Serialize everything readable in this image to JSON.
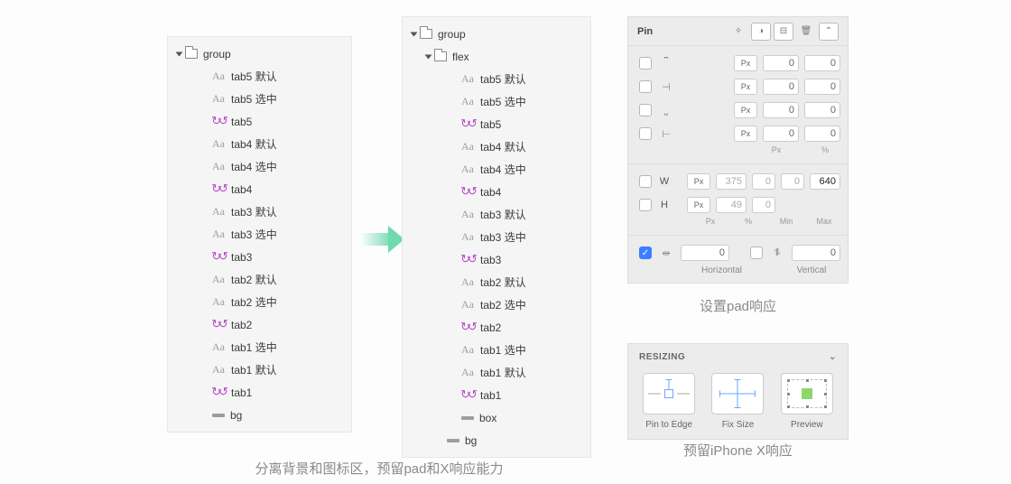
{
  "left_tree": {
    "root_label": "group",
    "items": [
      {
        "icon": "text",
        "label": "tab5 默认"
      },
      {
        "icon": "text",
        "label": "tab5 选中"
      },
      {
        "icon": "artboard",
        "label": "tab5"
      },
      {
        "icon": "text",
        "label": "tab4 默认"
      },
      {
        "icon": "text",
        "label": "tab4 选中"
      },
      {
        "icon": "artboard",
        "label": "tab4"
      },
      {
        "icon": "text",
        "label": "tab3 默认"
      },
      {
        "icon": "text",
        "label": "tab3 选中"
      },
      {
        "icon": "artboard",
        "label": "tab3"
      },
      {
        "icon": "text",
        "label": "tab2 默认"
      },
      {
        "icon": "text",
        "label": "tab2 选中"
      },
      {
        "icon": "artboard",
        "label": "tab2"
      },
      {
        "icon": "text",
        "label": "tab1 选中"
      },
      {
        "icon": "text",
        "label": "tab1 默认"
      },
      {
        "icon": "artboard",
        "label": "tab1"
      },
      {
        "icon": "rect",
        "label": "bg"
      }
    ]
  },
  "right_tree": {
    "root_label": "group",
    "sub_label": "flex",
    "items": [
      {
        "icon": "text",
        "label": "tab5 默认"
      },
      {
        "icon": "text",
        "label": "tab5 选中"
      },
      {
        "icon": "artboard",
        "label": "tab5"
      },
      {
        "icon": "text",
        "label": "tab4 默认"
      },
      {
        "icon": "text",
        "label": "tab4 选中"
      },
      {
        "icon": "artboard",
        "label": "tab4"
      },
      {
        "icon": "text",
        "label": "tab3 默认"
      },
      {
        "icon": "text",
        "label": "tab3 选中"
      },
      {
        "icon": "artboard",
        "label": "tab3"
      },
      {
        "icon": "text",
        "label": "tab2 默认"
      },
      {
        "icon": "text",
        "label": "tab2 选中"
      },
      {
        "icon": "artboard",
        "label": "tab2"
      },
      {
        "icon": "text",
        "label": "tab1 选中"
      },
      {
        "icon": "text",
        "label": "tab1 默认"
      },
      {
        "icon": "artboard",
        "label": "tab1"
      },
      {
        "icon": "rect",
        "label": "box"
      },
      {
        "icon": "rect",
        "label": "bg"
      }
    ]
  },
  "captions": {
    "bottom": "分离背景和图标区，预留pad和X响应能力",
    "panel1": "设置pad响应",
    "panel2": "预留iPhone X响应"
  },
  "pin": {
    "title": "Pin",
    "px": "Px",
    "edges": [
      {
        "icon": "⎴",
        "v1": "0",
        "v2": "0"
      },
      {
        "icon": "⊣",
        "v1": "0",
        "v2": "0"
      },
      {
        "icon": "⎵",
        "v1": "0",
        "v2": "0"
      },
      {
        "icon": "⊢",
        "v1": "0",
        "v2": "0"
      }
    ],
    "units2": [
      "Px",
      "%"
    ],
    "w_label": "W",
    "h_label": "H",
    "w": {
      "px": "375",
      "pct": "0",
      "min": "0",
      "max": "640"
    },
    "h": {
      "px": "49",
      "pct": "0",
      "min": "Min",
      "max": "Max"
    },
    "units4": [
      "Px",
      "%",
      "Min",
      "Max"
    ],
    "hv": {
      "h_val": "0",
      "v_val": "0",
      "h_label": "Horizontal",
      "v_label": "Vertical"
    }
  },
  "resizing": {
    "title": "RESIZING",
    "cells": [
      "Pin to Edge",
      "Fix Size",
      "Preview"
    ]
  }
}
